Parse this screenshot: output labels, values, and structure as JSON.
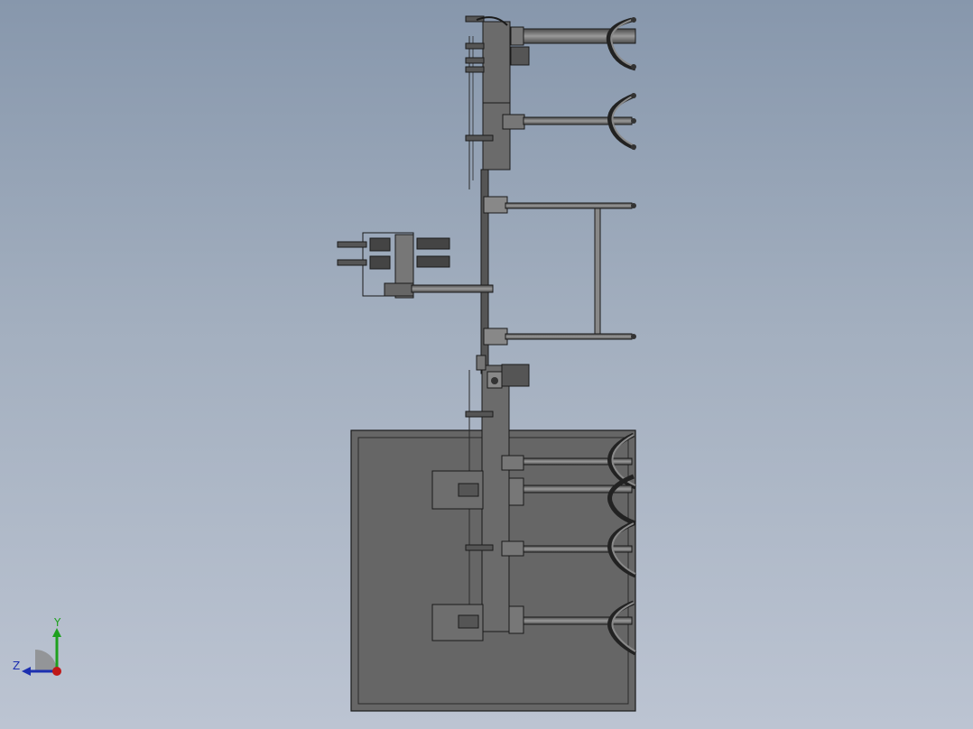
{
  "viewport": {
    "background_top": "#8797ac",
    "background_bottom": "#bcc4d2"
  },
  "triad": {
    "x_label": "",
    "y_label": "Y",
    "z_label": "Z",
    "y_color": "#1ea01e",
    "z_color": "#1c2fb0",
    "origin_color": "#c01818"
  },
  "model": {
    "fill_dark": "#616161",
    "fill_mid": "#7a7a7a",
    "fill_light": "#9a9a9a",
    "edge_color": "#1a1a1a"
  }
}
